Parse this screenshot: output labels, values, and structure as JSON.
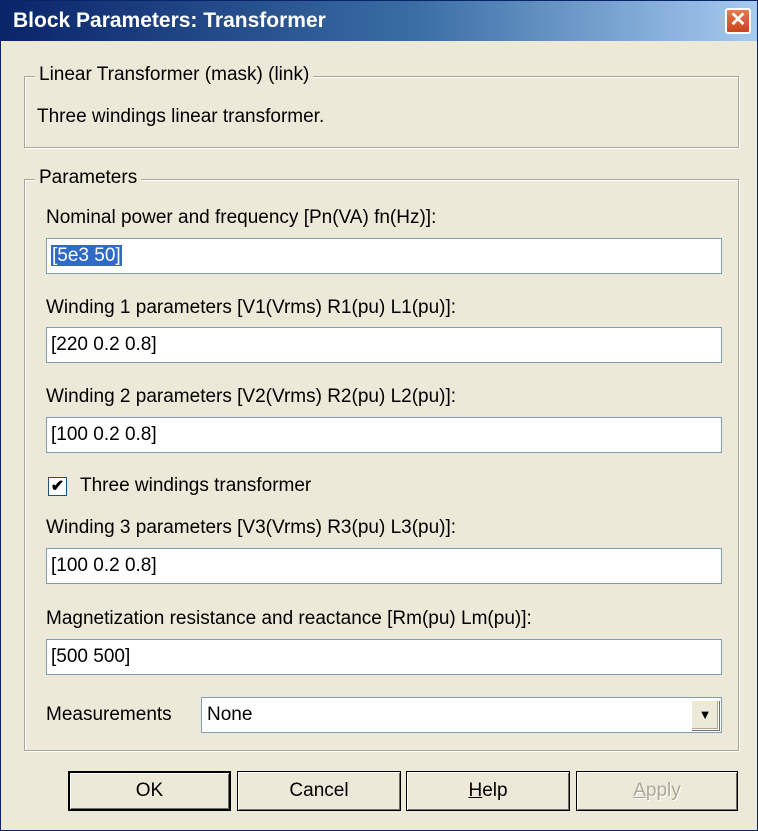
{
  "window": {
    "title": "Block Parameters: Transformer",
    "close_glyph": "✕"
  },
  "description_group": {
    "legend": "Linear Transformer (mask) (link)",
    "text": "Three windings linear transformer."
  },
  "parameters_group": {
    "legend": "Parameters",
    "nominal": {
      "label": "Nominal power and frequency [Pn(VA) fn(Hz)]:",
      "value": "[5e3 50]"
    },
    "winding1": {
      "label": "Winding 1 parameters [V1(Vrms) R1(pu) L1(pu)]:",
      "value": "[220 0.2 0.8]"
    },
    "winding2": {
      "label": "Winding 2 parameters [V2(Vrms) R2(pu) L2(pu)]:",
      "value": "[100 0.2 0.8]"
    },
    "three_windings": {
      "label": "Three windings transformer",
      "checked": true,
      "mark": "✔"
    },
    "winding3": {
      "label": "Winding 3 parameters [V3(Vrms) R3(pu) L3(pu)]:",
      "value": "[100 0.2 0.8]"
    },
    "magnetization": {
      "label": "Magnetization resistance and reactance [Rm(pu) Lm(pu)]:",
      "value": "[500 500]"
    },
    "measurements": {
      "label": "Measurements",
      "value": "None",
      "arrow": "▼"
    }
  },
  "buttons": {
    "ok": "OK",
    "cancel": "Cancel",
    "help_underlined": "H",
    "help_rest": "elp",
    "apply_underlined": "A",
    "apply_rest": "pply"
  }
}
